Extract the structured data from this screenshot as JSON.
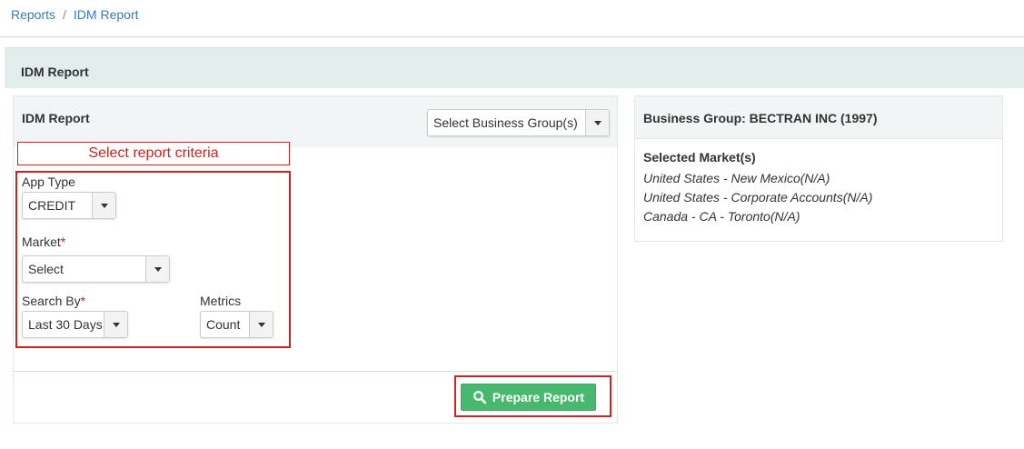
{
  "breadcrumb": {
    "root": "Reports",
    "separator": "/",
    "current": "IDM Report"
  },
  "page_header": {
    "title": "IDM Report"
  },
  "report_panel": {
    "title": "IDM Report",
    "business_group_select": {
      "value": "Select Business Group(s)"
    },
    "criteria_label": "Select report criteria",
    "app_type": {
      "label": "App Type",
      "value": "CREDIT"
    },
    "market": {
      "label": "Market",
      "required_mark": "*",
      "value": "Select"
    },
    "search_by": {
      "label": "Search By",
      "required_mark": "*",
      "value": "Last 30 Days"
    },
    "metrics": {
      "label": "Metrics",
      "value": "Count"
    },
    "prepare_button": {
      "label": "Prepare Report",
      "icon": "search-icon"
    }
  },
  "business_group_panel": {
    "title": "Business Group: BECTRAN INC (1997)",
    "markets_title": "Selected Market(s)",
    "markets": [
      "United States - New Mexico(N/A)",
      "United States - Corporate Accounts(N/A)",
      "Canada - CA - Toronto(N/A)"
    ]
  },
  "colors": {
    "link": "#3a7ab5",
    "header_bg": "#e3eeec",
    "highlight_red": "#cc2222",
    "button_green": "#47b86e"
  }
}
